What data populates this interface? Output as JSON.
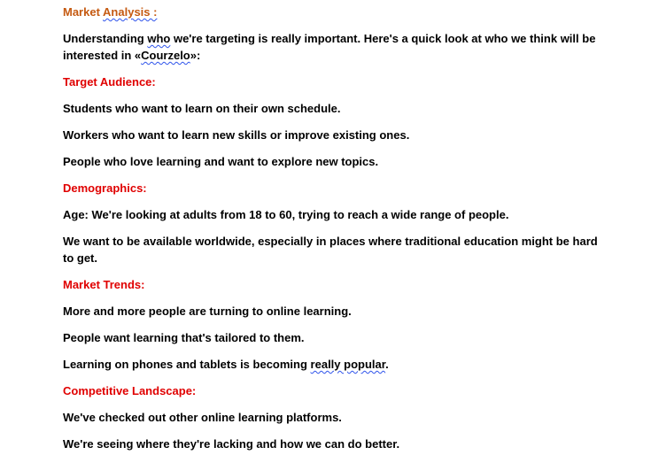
{
  "doc": {
    "market_analysis": {
      "heading_a": "Market ",
      "heading_b": "Analysis :",
      "intro_a": "Understanding ",
      "intro_b": "who",
      "intro_c": " we're targeting is really important. Here's a quick look at who we think will be interested in «",
      "intro_d": "Courzelo",
      "intro_e": "»:"
    },
    "target_audience": {
      "heading": "Target Audience:",
      "items": [
        "Students who want to learn on their own schedule.",
        "Workers who want to learn new skills or improve existing ones.",
        "People who love learning and want to explore new topics."
      ]
    },
    "demographics": {
      "heading": "Demographics:",
      "items": [
        "Age: We're looking at adults from 18 to 60, trying to reach a wide range of people.",
        "We want to be available worldwide, especially in places where traditional education might be hard to get."
      ]
    },
    "market_trends": {
      "heading": "Market Trends:",
      "items": [
        "More and more people are turning to online learning.",
        "People want learning that's tailored to them."
      ],
      "last_a": "Learning on phones and tablets is becoming ",
      "last_b": "really popular",
      "last_c": "."
    },
    "competitive_landscape": {
      "heading": "Competitive Landscape:",
      "items": [
        "We've checked out other online learning platforms.",
        "We're seeing where they're lacking and how we can do better."
      ]
    }
  }
}
